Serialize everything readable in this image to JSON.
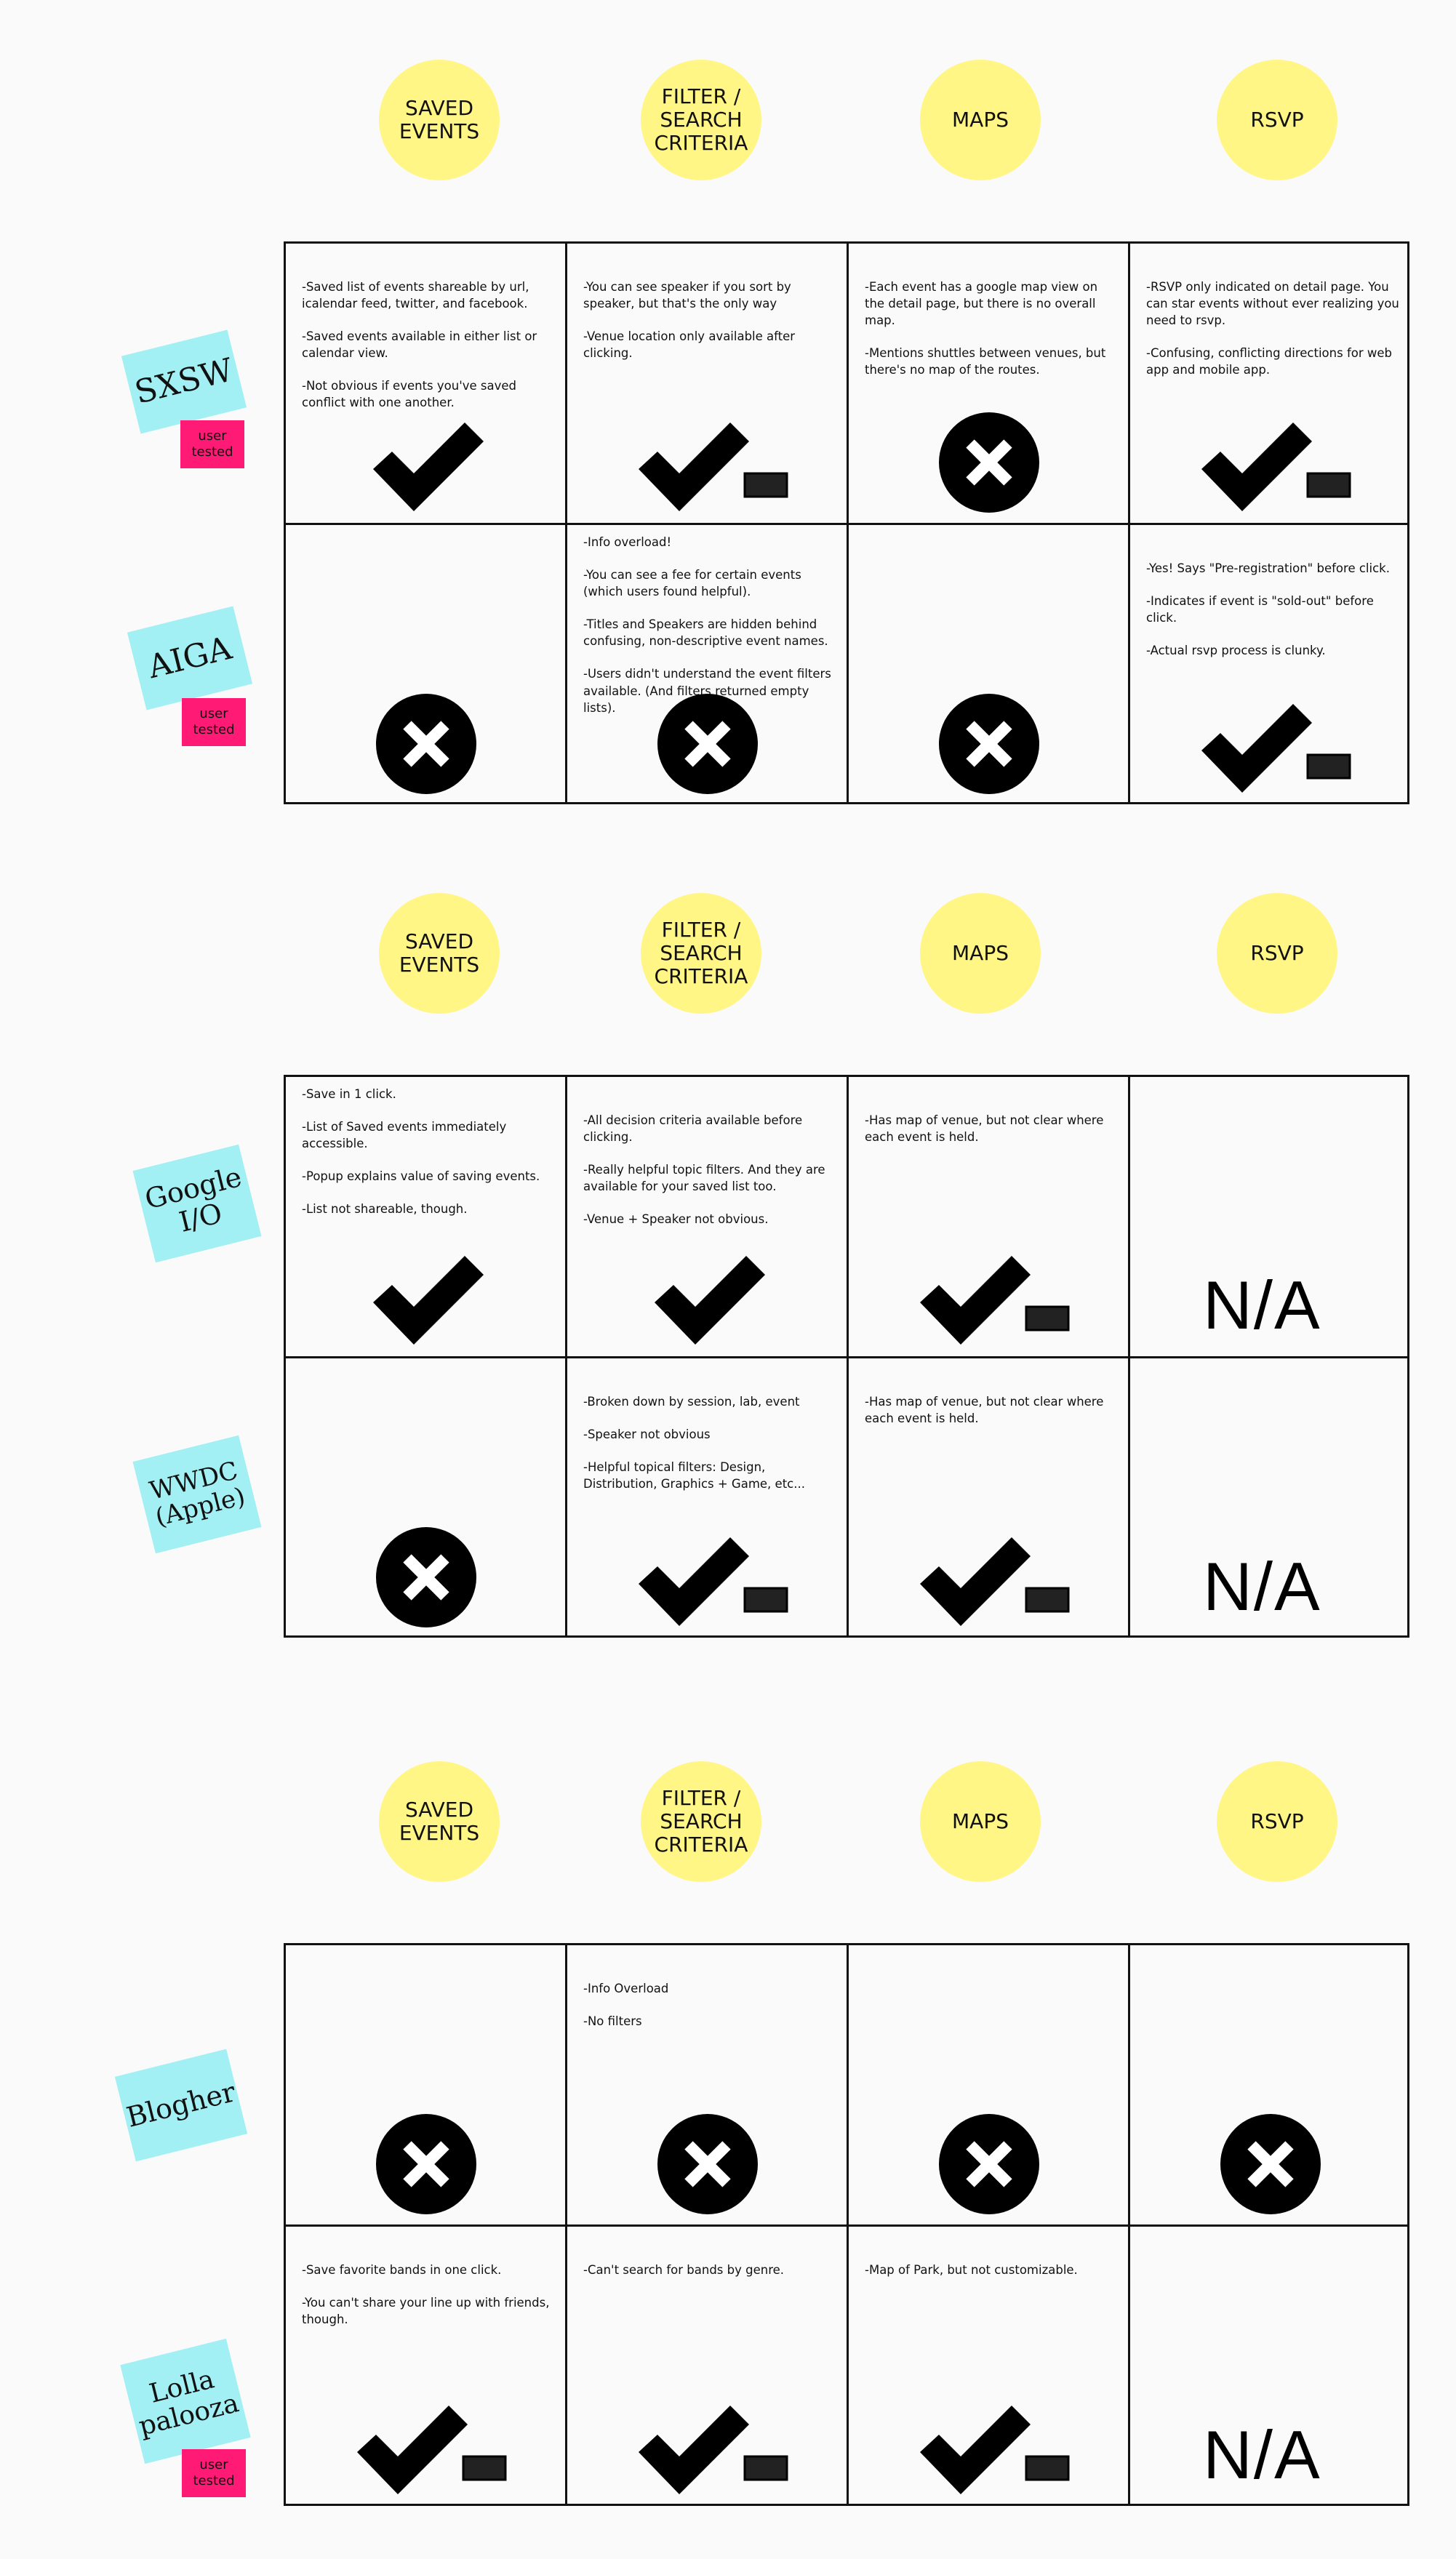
{
  "columns": [
    "SAVED\nEVENTS",
    "FILTER /\nSEARCH\nCRITERIA",
    "MAPS",
    "RSVP"
  ],
  "tag_label": "user\ntested",
  "na_label": "N/A",
  "sections": [
    {
      "rows": [
        {
          "name": "SXSW",
          "tested": true,
          "cells": [
            {
              "mark": "check",
              "notes": [
                "-Saved list of events shareable by url, icalendar feed, twitter, and facebook.",
                "-Saved events available in either list or calendar view.",
                "-Not obvious if events you've saved conflict with one another."
              ]
            },
            {
              "mark": "check-minus",
              "notes": [
                "-You can see speaker if you sort by speaker, but that's the only way",
                "-Venue location only available after clicking."
              ]
            },
            {
              "mark": "x",
              "notes": [
                "-Each event has a google map view on the detail page, but there is no overall map.",
                "-Mentions shuttles between venues, but there's no map of the routes."
              ]
            },
            {
              "mark": "check-minus",
              "notes": [
                "-RSVP only indicated on detail page. You can star events without ever realizing you need to rsvp.",
                "-Confusing, conflicting directions for web app and mobile app."
              ]
            }
          ]
        },
        {
          "name": "AIGA",
          "tested": true,
          "cells": [
            {
              "mark": "x",
              "notes": []
            },
            {
              "mark": "x",
              "notes": [
                "-Info overload!",
                "-You can see a fee for certain events (which users found helpful).",
                "-Titles and Speakers are hidden behind confusing, non-descriptive event names.",
                "-Users didn't understand the event filters available. (And filters returned empty lists)."
              ]
            },
            {
              "mark": "x",
              "notes": []
            },
            {
              "mark": "check-minus",
              "notes": [
                "-Yes! Says \"Pre-registration\" before click.",
                "-Indicates if event is \"sold-out\" before click.",
                "-Actual rsvp process is clunky."
              ]
            }
          ]
        }
      ]
    },
    {
      "rows": [
        {
          "name": "Google\nI/O",
          "tested": false,
          "cells": [
            {
              "mark": "check",
              "notes": [
                "-Save in 1 click.",
                "-List of Saved events immediately accessible.",
                "-Popup explains value of saving events.",
                "-List not shareable, though."
              ]
            },
            {
              "mark": "check",
              "notes": [
                "-All decision criteria available before clicking.",
                "-Really helpful topic filters. And they are available for your saved list too.",
                "-Venue + Speaker not obvious."
              ]
            },
            {
              "mark": "check-minus",
              "notes": [
                "-Has map of venue, but not clear where each event is held."
              ]
            },
            {
              "mark": "na",
              "notes": []
            }
          ]
        },
        {
          "name": "WWDC\n(Apple)",
          "tested": false,
          "cells": [
            {
              "mark": "x",
              "notes": []
            },
            {
              "mark": "check-minus",
              "notes": [
                "-Broken down by session, lab, event",
                "-Speaker not obvious",
                "-Helpful topical filters: Design, Distribution, Graphics + Game, etc..."
              ]
            },
            {
              "mark": "check-minus",
              "notes": [
                "-Has map of venue, but not clear where each event is held."
              ]
            },
            {
              "mark": "na",
              "notes": []
            }
          ]
        }
      ]
    },
    {
      "rows": [
        {
          "name": "Blogher",
          "tested": false,
          "cells": [
            {
              "mark": "x",
              "notes": []
            },
            {
              "mark": "x",
              "notes": [
                "-Info Overload",
                "-No filters"
              ]
            },
            {
              "mark": "x",
              "notes": []
            },
            {
              "mark": "x",
              "notes": []
            }
          ]
        },
        {
          "name": "Lolla\npalooza",
          "tested": true,
          "cells": [
            {
              "mark": "check-minus",
              "notes": [
                "-Save favorite bands in one click.",
                "-You can't share your line up with friends, though."
              ]
            },
            {
              "mark": "check-minus",
              "notes": [
                "-Can't search for bands by genre."
              ]
            },
            {
              "mark": "check-minus",
              "notes": [
                "-Map of Park, but not customizable."
              ]
            },
            {
              "mark": "na",
              "notes": []
            }
          ]
        }
      ]
    }
  ]
}
